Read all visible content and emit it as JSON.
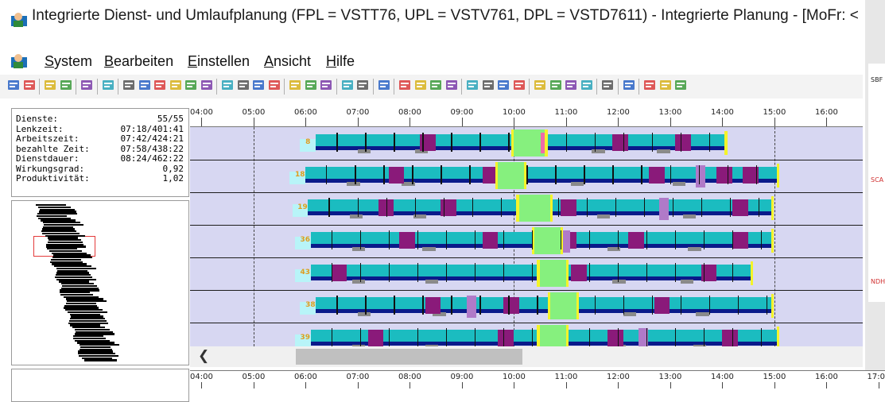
{
  "window": {
    "title": "Integrierte Dienst- und Umlaufplanung (FPL = VSTT76, UPL = VSTV761, DPL = VSTD7611) - Integrierte Planung - [MoFr: <"
  },
  "menu": {
    "items": [
      {
        "label": "System"
      },
      {
        "label": "Bearbeiten"
      },
      {
        "label": "Einstellen"
      },
      {
        "label": "Ansicht"
      },
      {
        "label": "Hilfe"
      }
    ]
  },
  "stats": {
    "rows": [
      {
        "key": "Dienste:",
        "value": "55/55"
      },
      {
        "key": "Lenkzeit:",
        "value": "07:18/401:41"
      },
      {
        "key": "Arbeitszeit:",
        "value": "07:42/424:21"
      },
      {
        "key": "bezahlte Zeit:",
        "value": "07:58/438:22"
      },
      {
        "key": "Dienstdauer:",
        "value": "08:24/462:22"
      },
      {
        "key": "Wirkungsgrad:",
        "value": "0,92"
      },
      {
        "key": "Produktivität:",
        "value": "1,02"
      }
    ]
  },
  "timeline": {
    "ticks": [
      "04:00",
      "05:00",
      "06:00",
      "07:00",
      "08:00",
      "09:00",
      "10:00",
      "11:00",
      "12:00",
      "13:00",
      "14:00",
      "15:00",
      "16:00"
    ],
    "ticks_bottom": [
      "04:00",
      "05:00",
      "06:00",
      "07:00",
      "08:00",
      "09:00",
      "10:00",
      "11:00",
      "12:00",
      "13:00",
      "14:00",
      "15:00",
      "16:00",
      "17:00"
    ]
  },
  "duties": [
    {
      "label": "8"
    },
    {
      "label": "18"
    },
    {
      "label": "19"
    },
    {
      "label": "36"
    },
    {
      "label": "43"
    },
    {
      "label": "38"
    },
    {
      "label": "39"
    }
  ],
  "right_panel": {
    "labels": [
      "SBF",
      "SCA",
      "NDH"
    ]
  },
  "colors": {
    "teal": "#1bbcc0",
    "navy": "#0a1a8a",
    "purple": "#8a1a7a",
    "pause_green": "#86f07e",
    "yellow": "#f4f42a",
    "lane_bg": "#d7d7f2"
  }
}
